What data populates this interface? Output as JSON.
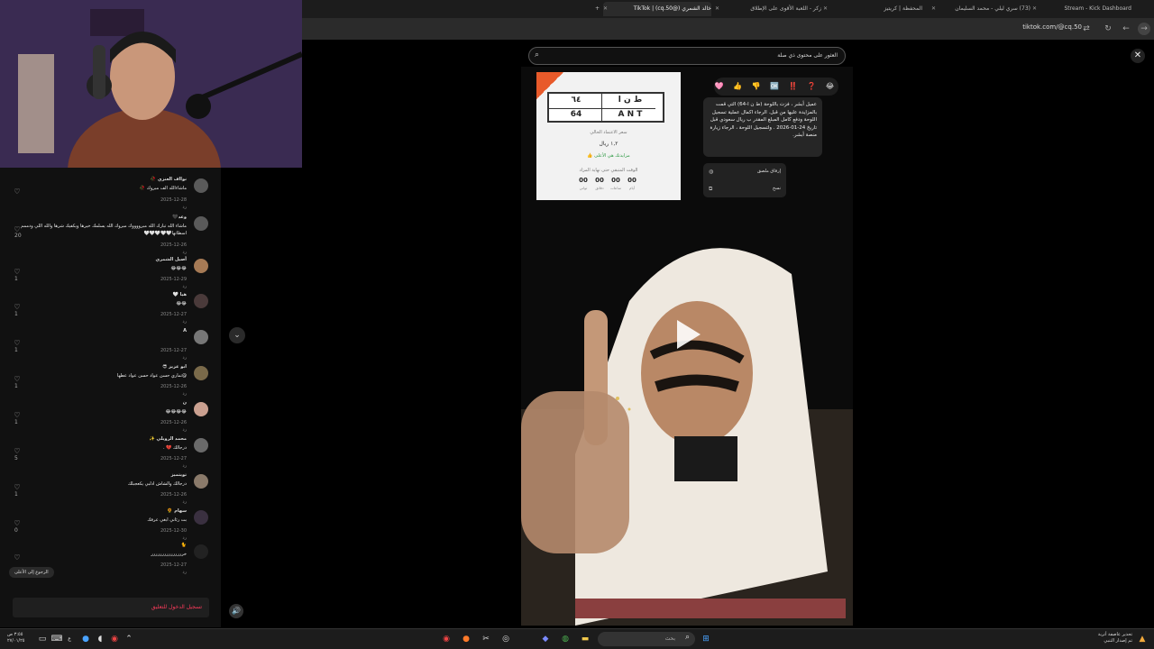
{
  "tabs": [
    {
      "label": "Stream - Kick Dashboard"
    },
    {
      "label": "(73) سري ليلي - محمد السليمان"
    },
    {
      "label": "المحفظة | كريتيز"
    },
    {
      "label": "زكر - اللعبة الأقوى على الإطلاق"
    },
    {
      "label": "خالد الشمري (@cq.50) | TikTok"
    }
  ],
  "address_bar": {
    "url": "tiktok.com/@cq.50"
  },
  "search": {
    "text": "العثور على محتوى ذي صلة"
  },
  "comments": [
    {
      "name": "نوااف العنزي 🥀",
      "text": "ماشاءالله الف مبروك 🥀",
      "date": "2025-12-28",
      "likes": ""
    },
    {
      "name": "وعد🖤",
      "text": "ماشاء الله تبارك الله مبرووووك مبروك الله يسلمك خيرها ويكفيك شرها والله اللي ودممم اسطاتها🤍🤍🤍🤍🤍",
      "date": "2025-12-26",
      "likes": "20"
    },
    {
      "name": "أصيل الشمري",
      "text": "😂😂😂",
      "date": "2025-12-29",
      "likes": "1"
    },
    {
      "name": "هيا 🤍",
      "text": "😂😂",
      "date": "2025-12-27",
      "likes": "1"
    },
    {
      "name": "A",
      "text": "",
      "date": "2025-12-27",
      "likes": "1"
    },
    {
      "name": "ابو عزيز 😎",
      "text": "@تماري حسن عواد حسن عواد عطها",
      "date": "2025-12-26",
      "likes": "1"
    },
    {
      "name": "ن",
      "text": "😂😂😂😂",
      "date": "2025-12-26",
      "likes": "1"
    },
    {
      "name": "محمد الرويلي ✨",
      "text": "درجالك 💔 .",
      "date": "2025-12-27",
      "likes": "5"
    },
    {
      "name": "تويتميز",
      "text": "درجالك والشاش ادلبي يكعجبلك",
      "date": "2025-12-26",
      "likes": "1"
    },
    {
      "name": "سهام 🌻",
      "text": "بت رئاني ابغي عرفك",
      "date": "2025-12-30",
      "likes": "0"
    },
    {
      "name": "🐈",
      "text": "خررررررررررررررر",
      "date": "2025-12-27",
      "likes": "1"
    }
  ],
  "comments_panel": {
    "back_to_top": "الرجوع إلى الأعلى",
    "login_prompt": "تسجيل الدخول للتعليق",
    "reply_label": "رد"
  },
  "plate": {
    "arabic_letters": "ط ن ا",
    "arabic_digits": "٦٤",
    "latin_letters": "A N T",
    "latin_digits": "64",
    "price_label": "سعر الاعتماد الحالي",
    "price_value": "١,٢ ريال",
    "bid_status": "👍 مزايدتك هي الأعلى",
    "remaining_label": "الوقت المتبقي حتى نهاية المزاد",
    "countdown": [
      {
        "value": "00",
        "unit": "أيام"
      },
      {
        "value": "00",
        "unit": "ساعات"
      },
      {
        "value": "00",
        "unit": "دقائق"
      },
      {
        "value": "00",
        "unit": "ثواني"
      }
    ]
  },
  "message": {
    "reactions": "🩷 👍 👎 🆗 ‼️ ❓ 😂",
    "text": "عميل أبشر ، فزت باللوحة (ط ن ا-64) التي قمت بالمزايدة عليها من قبل. الرجاء اكمال عملية تسجيل اللوحة ودفع كامل المبلغ المقدر ب ريال سعودي قبل تاريخ 24-01-2026 . ولتسجيل اللوحة ، الرجاء زيارة منصة أبشر.",
    "menu": [
      {
        "label": "إرفاق ملصق",
        "icon": "sticker-icon"
      },
      {
        "label": "نسخ",
        "icon": "copy-icon"
      }
    ]
  },
  "taskbar": {
    "search_placeholder": "بحث",
    "clock_time": "٣:٥٥ ص",
    "clock_date": "٢٧/٠١/٢٥",
    "alert_title": "تحذير عاصفة أتربة",
    "alert_sub": "تم إصدار التنبي",
    "lang": "ع"
  }
}
